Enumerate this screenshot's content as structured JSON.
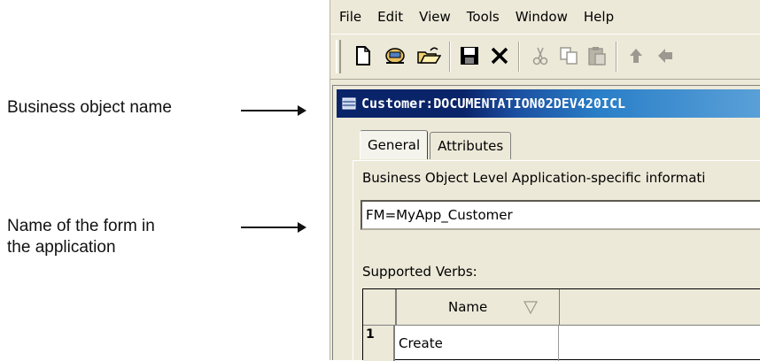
{
  "callouts": {
    "business_object": "Business object name",
    "form_name_line1": "Name of the form in",
    "form_name_line2": "the application"
  },
  "menu": [
    "File",
    "Edit",
    "View",
    "Tools",
    "Window",
    "Help"
  ],
  "toolbar_icons": [
    "new-document-icon",
    "connect-icon",
    "open-folder-icon",
    "save-icon",
    "delete-icon",
    "cut-icon",
    "copy-icon",
    "paste-icon",
    "move-up-icon",
    "move-down-icon"
  ],
  "window": {
    "title": "Customer:DOCUMENTATION02DEV420ICL"
  },
  "tabs": [
    "General",
    "Attributes"
  ],
  "general": {
    "asi_label": "Business Object Level Application-specific informati",
    "asi_value": "FM=MyApp_Customer",
    "verbs_label": "Supported Verbs:",
    "columns": [
      "Name"
    ],
    "rows": [
      {
        "num": "1",
        "name": "Create"
      }
    ]
  },
  "colors": {
    "window_bg": "#ece9d8",
    "title_dark": "#0a246a",
    "title_light": "#5aa0d8"
  }
}
